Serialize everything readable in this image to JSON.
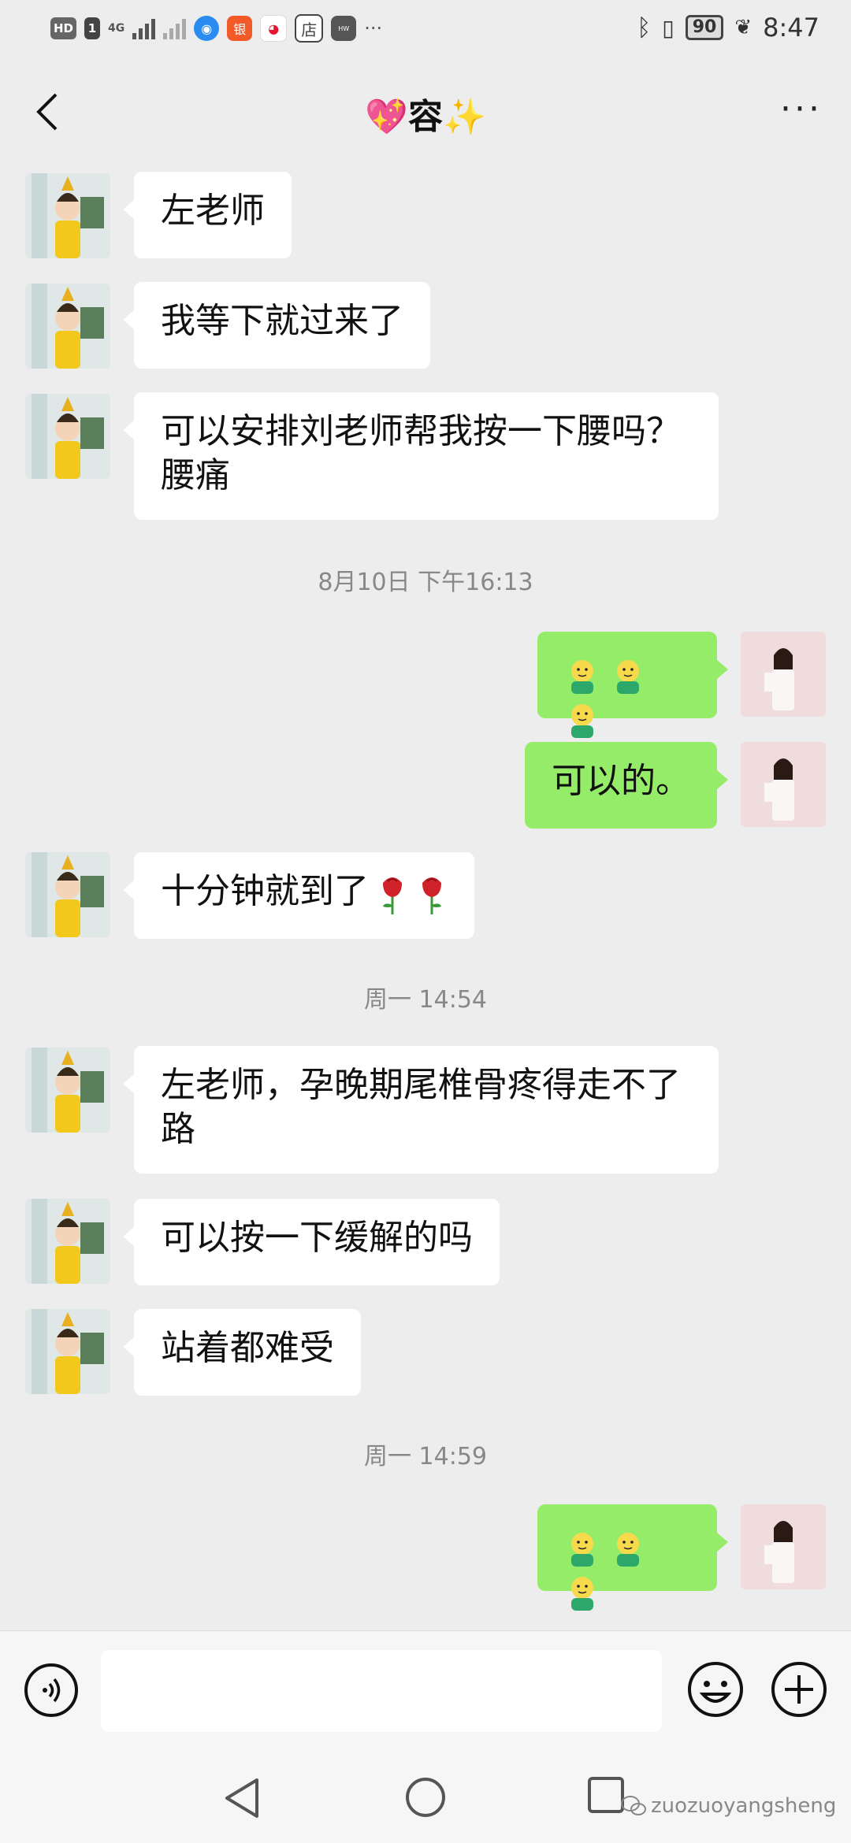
{
  "status_bar": {
    "hd_label": "HD",
    "sim_label": "1",
    "network_label": "4G",
    "app_icons": [
      "qq-browser-icon",
      "bank-app-icon",
      "weibo-icon",
      "store-app-icon",
      "huawei-app-icon"
    ],
    "shop_label": "店",
    "overflow": "···",
    "battery": "90",
    "time": "8:47"
  },
  "header": {
    "title": "💖容✨",
    "more_label": "···"
  },
  "messages": [
    {
      "side": "in",
      "text": "左老师"
    },
    {
      "side": "in",
      "text": "我等下就过来了"
    },
    {
      "side": "in",
      "text": "可以安排刘老师帮我按一下腰吗？\n腰痛"
    },
    {
      "type": "time",
      "text": "8月10日 下午16:13"
    },
    {
      "side": "out",
      "emoji": "smiley-x3"
    },
    {
      "side": "out",
      "text": "可以的。"
    },
    {
      "side": "in",
      "text": "十分钟就到了"
    },
    {
      "type": "time",
      "text": "周一 14:54"
    },
    {
      "side": "in",
      "text": "左老师，孕晚期尾椎骨疼得走不了\n路"
    },
    {
      "side": "in",
      "text": "可以按一下缓解的吗"
    },
    {
      "side": "in",
      "text": "站着都难受"
    },
    {
      "type": "time",
      "text": "周一 14:59"
    },
    {
      "side": "out",
      "emoji": "smiley-x3"
    }
  ],
  "colors": {
    "background": "#ededed",
    "incoming_bubble": "#ffffff",
    "outgoing_bubble": "#95ec69"
  },
  "input_bar": {
    "placeholder": ""
  },
  "watermark": "zuozuoyangsheng"
}
